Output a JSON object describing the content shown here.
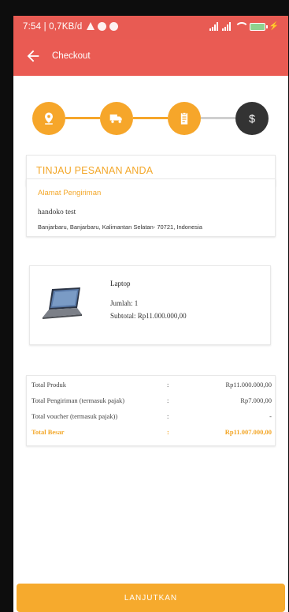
{
  "status_bar": {
    "time": "7:54 | 0,7KB/d"
  },
  "app_bar": {
    "title": "Checkout"
  },
  "stepper": {
    "steps": [
      {
        "icon": "location-pin-icon",
        "state": "done"
      },
      {
        "icon": "truck-icon",
        "state": "done"
      },
      {
        "icon": "clipboard-icon",
        "state": "done"
      },
      {
        "icon": "dollar-icon",
        "state": "current"
      }
    ],
    "active_color": "#f6a62a",
    "inactive_color": "#333333"
  },
  "review": {
    "title": "TINJAU PESANAN ANDA",
    "address_label": "Alamat Pengiriman",
    "recipient": "handoko test",
    "address": "Banjarbaru, Banjarbaru, Kalimantan Selatan- 70721, Indonesia"
  },
  "product": {
    "name": "Laptop",
    "quantity": "Jumlah: 1",
    "subtotal": "Subtotal: Rp11.000.000,00"
  },
  "summary": {
    "rows": [
      {
        "label": "Total Produk",
        "sep": ":",
        "value": "Rp11.000.000,00"
      },
      {
        "label": "Total Pengiriman (termasuk pajak)",
        "sep": ":",
        "value": "Rp7.000,00"
      },
      {
        "label": "Total voucher (termasuk pajak))",
        "sep": ":",
        "value": "-"
      },
      {
        "label": "Total Besar",
        "sep": ":",
        "value": "Rp11.007.000,00"
      }
    ]
  },
  "footer": {
    "continue_label": "LANJUTKAN"
  },
  "colors": {
    "header": "#ea5b53",
    "accent": "#f6aa2d"
  }
}
